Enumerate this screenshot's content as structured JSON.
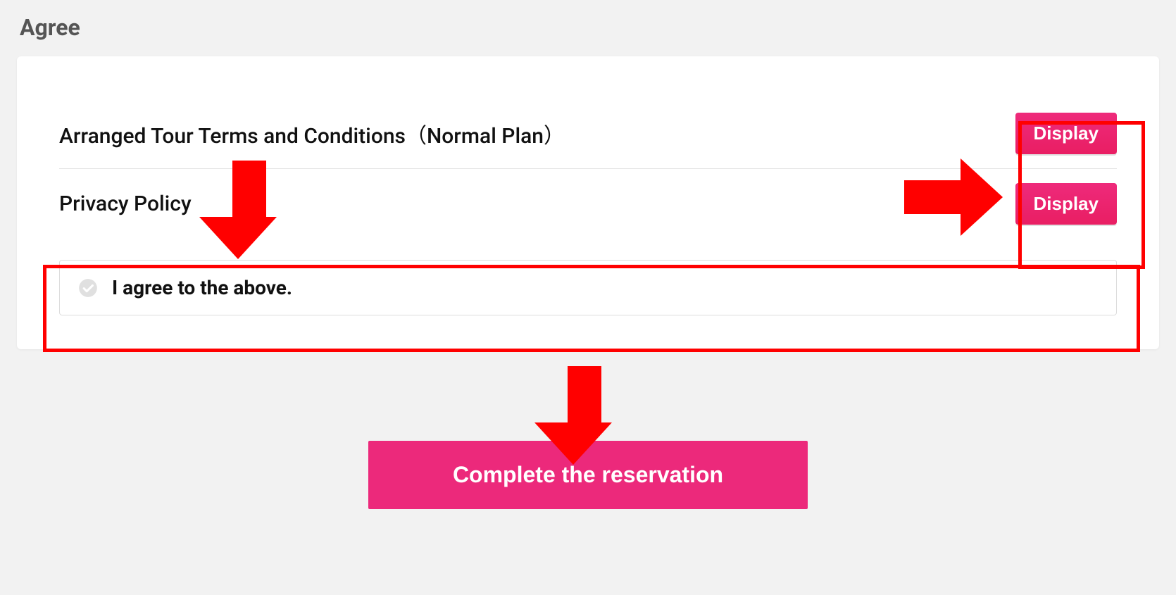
{
  "title": "Agree",
  "rows": [
    {
      "label": "Arranged Tour Terms and Conditions（Normal Plan）",
      "button": "Display"
    },
    {
      "label": "Privacy Policy",
      "button": "Display"
    }
  ],
  "agree": {
    "label": "I agree to the above.",
    "checked": false
  },
  "submit": {
    "label": "Complete the reservation"
  },
  "colors": {
    "accent": "#ec297b",
    "annotation": "#ff0000"
  }
}
